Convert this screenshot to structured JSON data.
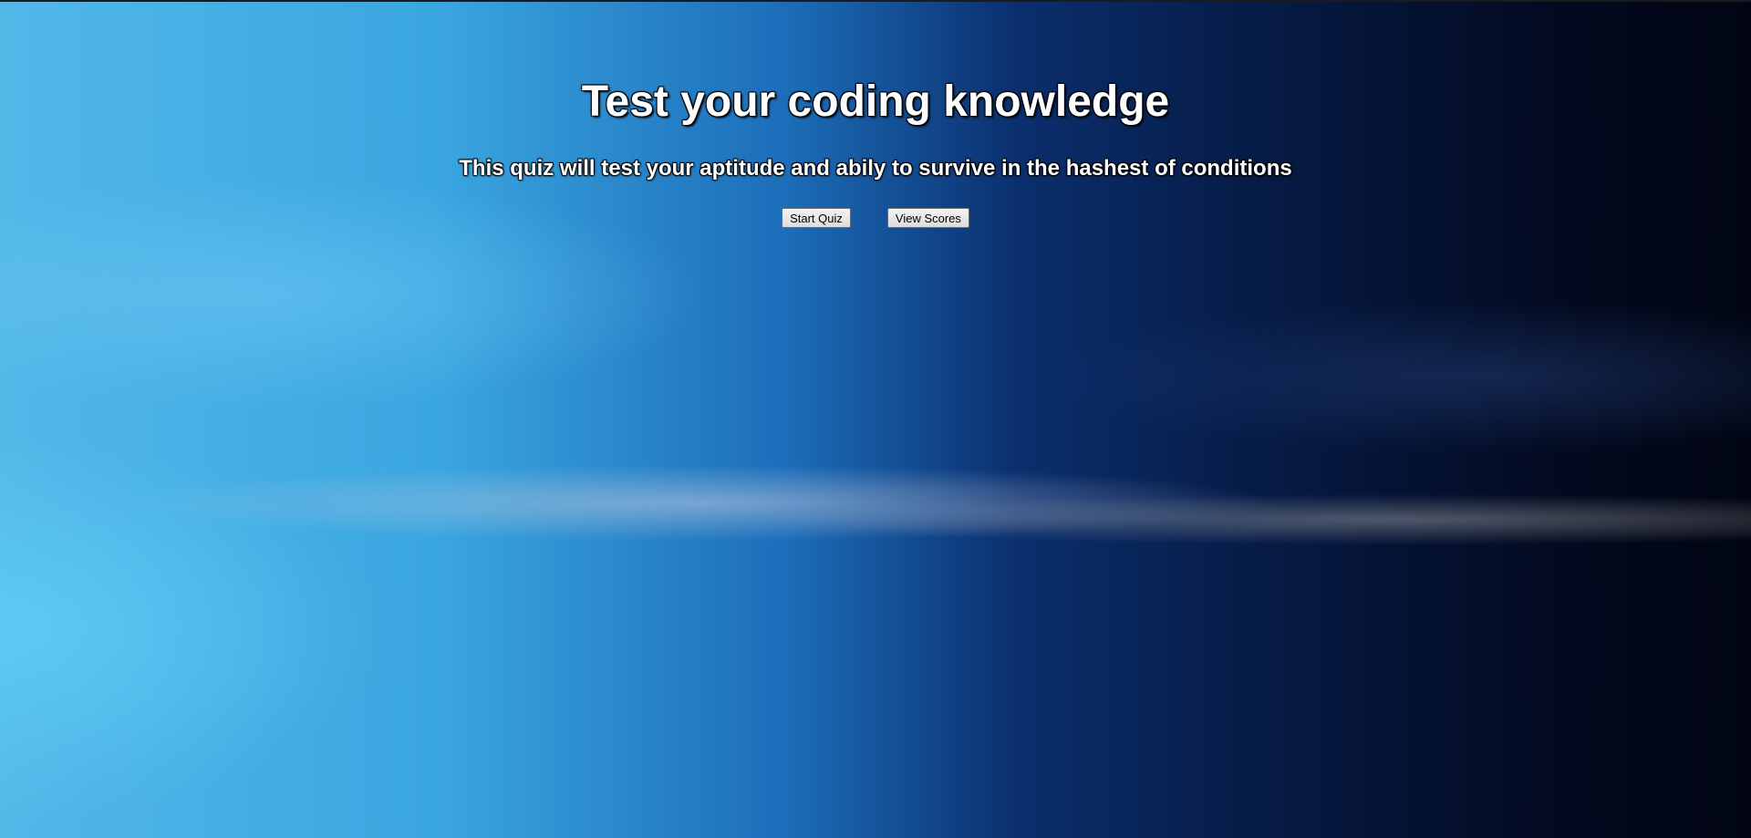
{
  "page": {
    "title": "Test your coding knowledge",
    "subtitle": "This quiz will test your aptitude and abily to survive in the hashest of conditions"
  },
  "actions": {
    "start_label": "Start Quiz",
    "scores_label": "View Scores"
  },
  "colors": {
    "heading_text": "#ffffff",
    "heading_outline": "#000000",
    "background_left": "#52b8e8",
    "background_right": "#010512"
  }
}
